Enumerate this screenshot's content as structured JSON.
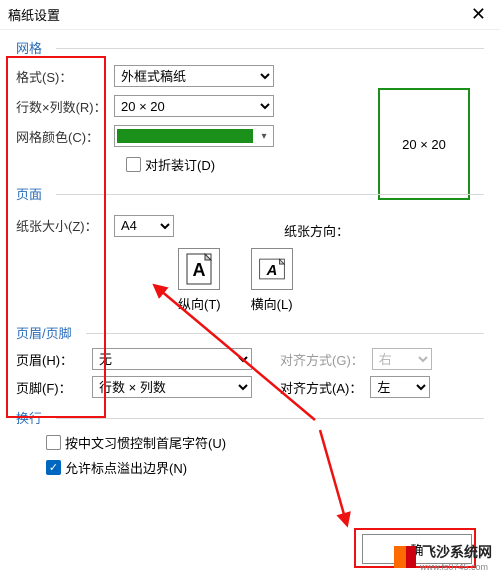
{
  "title": "稿纸设置",
  "sections": {
    "grid": "网格",
    "page": "页面",
    "headerfooter": "页眉/页脚",
    "wrap": "换行"
  },
  "labels": {
    "format": "格式(S)：",
    "rowscols": "行数×列数(R)：",
    "gridcolor": "网格颜色(C)：",
    "fold": "对折装订(D)",
    "papersize": "纸张大小(Z)：",
    "orientation": "纸张方向：",
    "portrait": "纵向(T)",
    "landscape": "横向(L)",
    "header": "页眉(H)：",
    "footer": "页脚(F)：",
    "alignG": "对齐方式(G)：",
    "alignA": "对齐方式(A)：",
    "cjk": "按中文习惯控制首尾字符(U)",
    "overflow": "允许标点溢出边界(N)"
  },
  "values": {
    "format": "外框式稿纸",
    "rowscols": "20 × 20",
    "papersize": "A4",
    "header": "无",
    "footer": "行数 × 列数",
    "alignG": "右",
    "alignA": "左",
    "gridcolor": "#1a8f1a",
    "preview": "20 × 20",
    "confirm": "确"
  },
  "watermark": {
    "text": "飞沙系统网",
    "url": "www.fs0745.com"
  }
}
